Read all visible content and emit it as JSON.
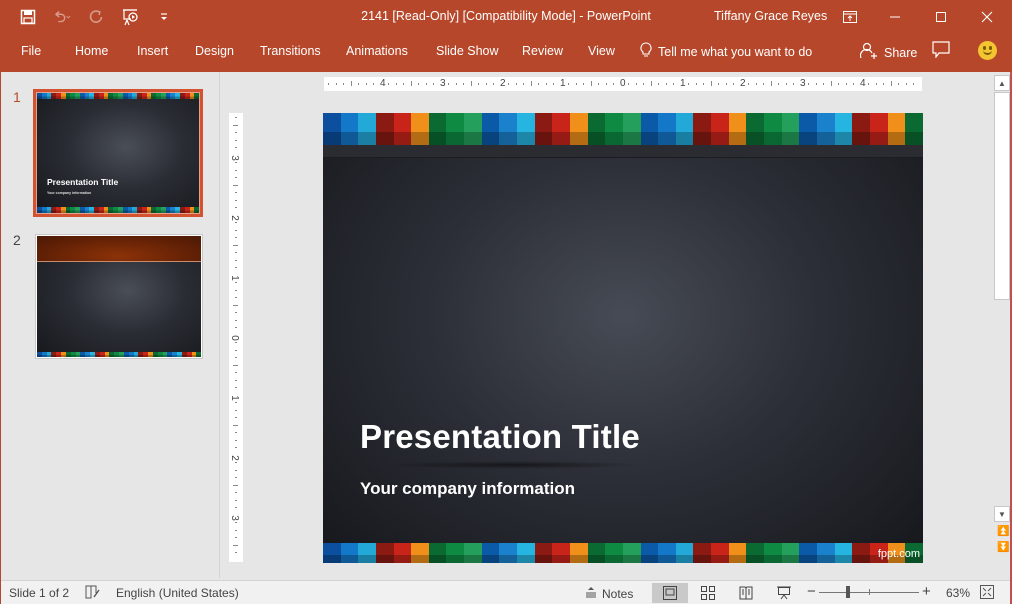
{
  "app": {
    "window_title": "2141 [Read-Only] [Compatibility Mode]  -  PowerPoint",
    "user_name": "Tiffany Grace Reyes",
    "accent_color": "#b7472a"
  },
  "quick_access": [
    {
      "icon": "save-icon"
    },
    {
      "icon": "undo-icon"
    },
    {
      "icon": "redo-icon"
    },
    {
      "icon": "start-from-beginning-icon"
    },
    {
      "icon": "customize-qat-icon"
    }
  ],
  "window_controls": [
    {
      "icon": "ribbon-display-options-icon"
    },
    {
      "icon": "minimize-icon"
    },
    {
      "icon": "maximize-icon"
    },
    {
      "icon": "close-icon"
    }
  ],
  "ribbon": {
    "tabs": [
      "File",
      "Home",
      "Insert",
      "Design",
      "Transitions",
      "Animations",
      "Slide Show",
      "Review",
      "View"
    ],
    "tell_me": "Tell me what you want to do",
    "share": "Share"
  },
  "thumbnails": [
    {
      "number": "1",
      "title": "Presentation Title",
      "subtitle": "Your company information",
      "selected": true
    },
    {
      "number": "2",
      "selected": false
    }
  ],
  "rulers": {
    "horizontal": [
      "4",
      "3",
      "2",
      "1",
      "0",
      "1",
      "2",
      "3",
      "4"
    ],
    "vertical": [
      "3",
      "2",
      "1",
      "0",
      "1",
      "2",
      "3"
    ]
  },
  "slide": {
    "title": "Presentation Title",
    "subtitle": "Your company information",
    "watermark": "fppt.com",
    "stripe_colors": [
      "#0b4f9e",
      "#1478c8",
      "#22a9d8",
      "#8b1a12",
      "#c8241a",
      "#f0901a",
      "#0a6a32",
      "#0e8a42",
      "#24a05c",
      "#0b5aa8",
      "#1a82cc",
      "#26b4e0",
      "#8b1a12",
      "#c8241a",
      "#f0901a",
      "#0a6a32",
      "#0e8a42",
      "#24a05c",
      "#0b5aa8",
      "#1478c8",
      "#22a9d8",
      "#8b1a12",
      "#c8241a",
      "#f0901a",
      "#0a6a32",
      "#0e8a42",
      "#24a05c",
      "#0b5aa8",
      "#1a82cc",
      "#26b4e0",
      "#8b1a12",
      "#c8241a",
      "#f0901a",
      "#0a6a32"
    ]
  },
  "statusbar": {
    "slide_info": "Slide 1 of 2",
    "language": "English (United States)",
    "notes": "Notes",
    "zoom_level": "63%",
    "zoom_percent": 63
  }
}
